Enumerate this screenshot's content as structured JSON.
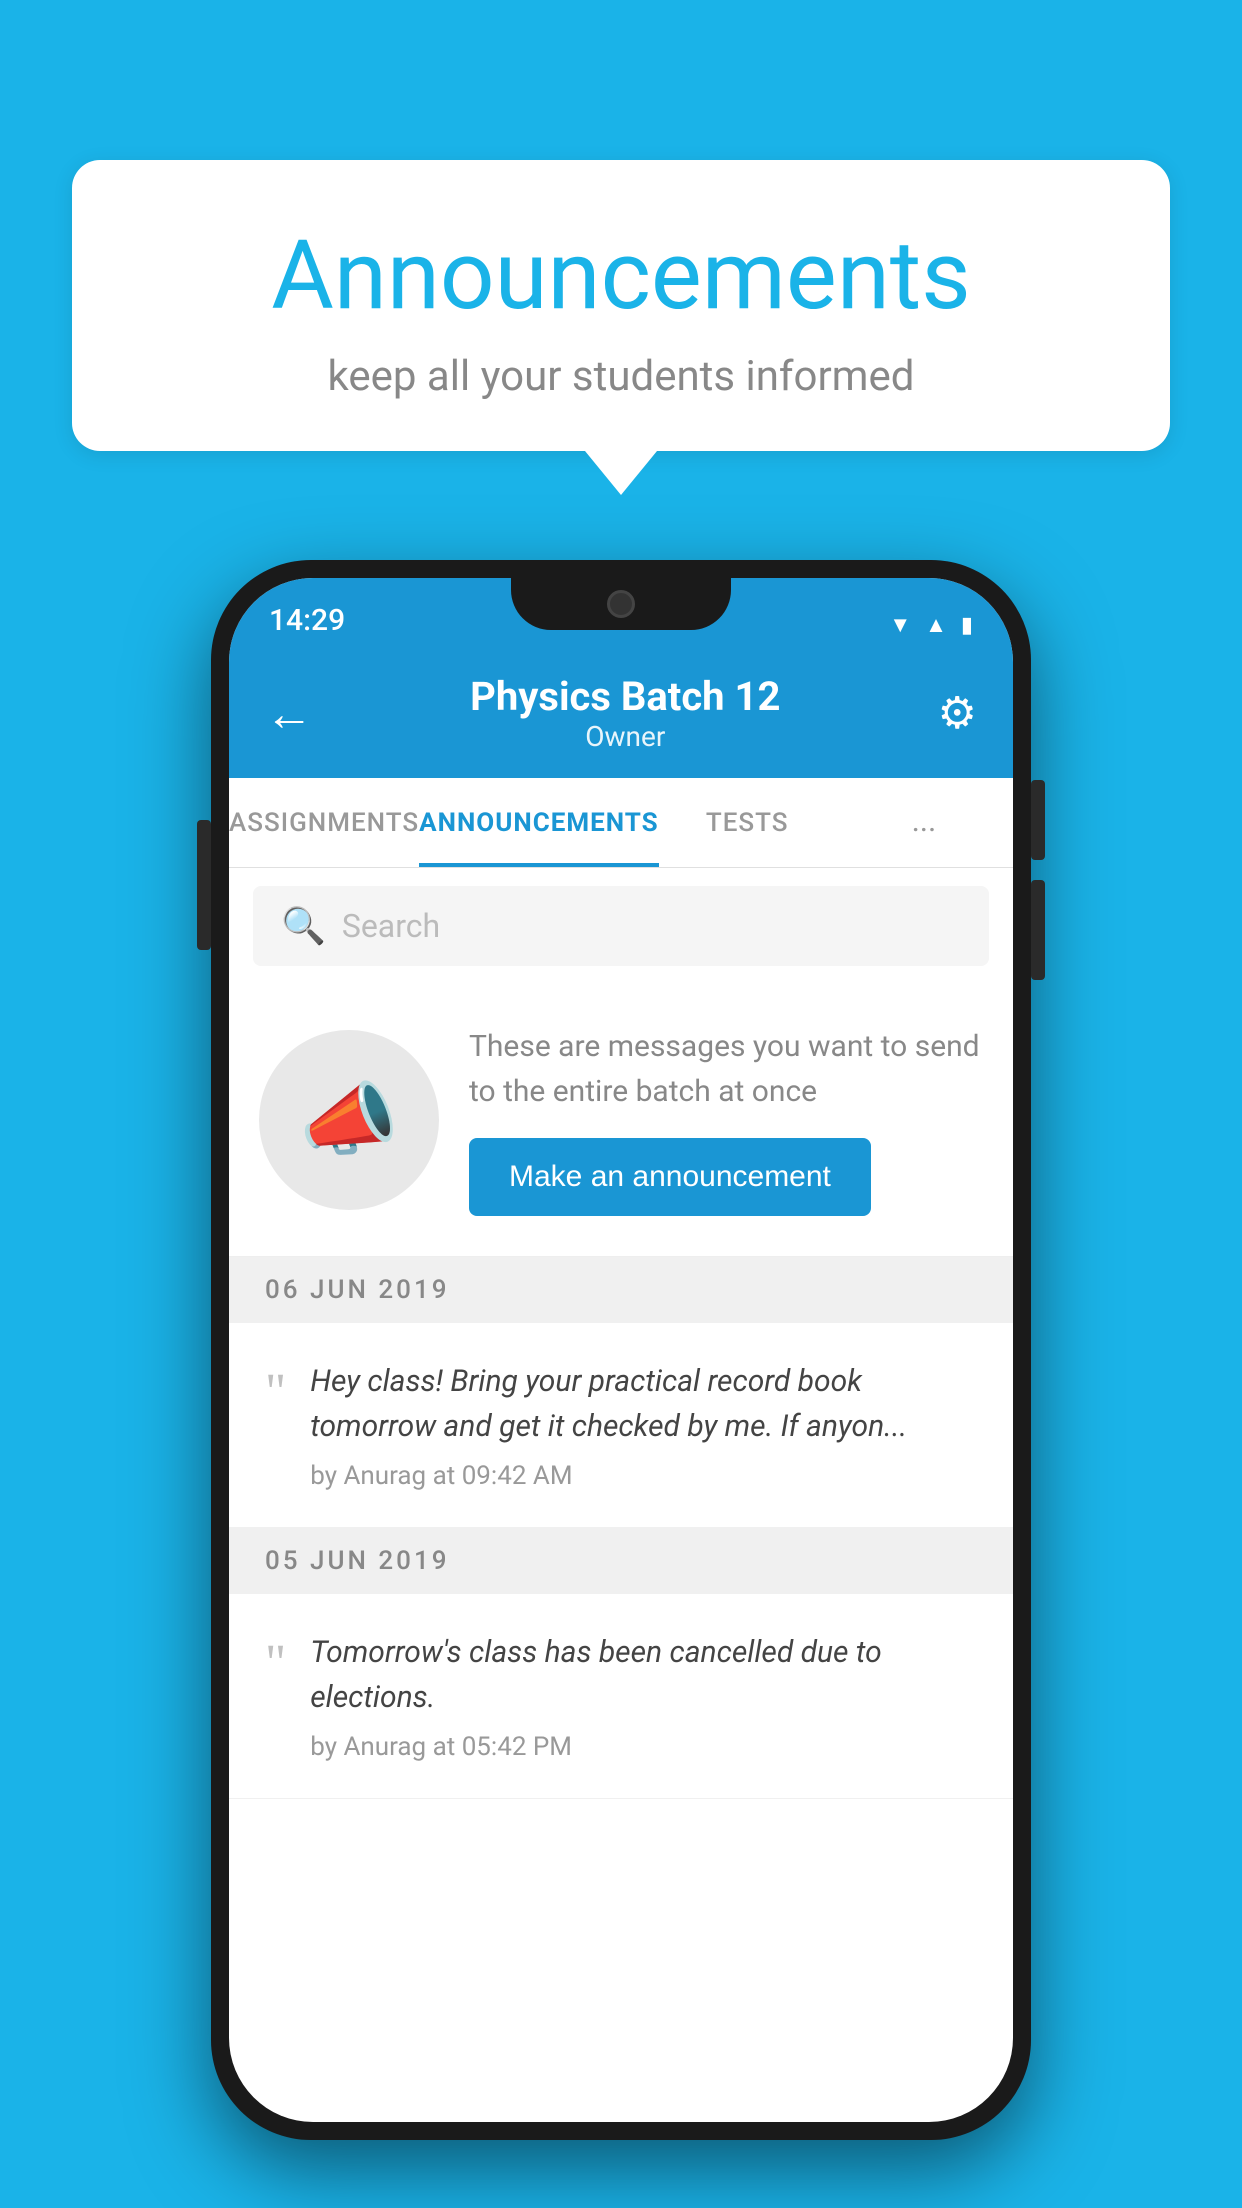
{
  "background_color": "#1ab3e8",
  "speech_bubble": {
    "title": "Announcements",
    "subtitle": "keep all your students informed"
  },
  "phone": {
    "status_bar": {
      "time": "14:29",
      "icons": [
        "wifi",
        "signal",
        "battery"
      ]
    },
    "top_bar": {
      "back_label": "←",
      "title": "Physics Batch 12",
      "subtitle": "Owner",
      "gear_label": "⚙"
    },
    "tabs": [
      {
        "label": "ASSIGNMENTS",
        "active": false
      },
      {
        "label": "ANNOUNCEMENTS",
        "active": true
      },
      {
        "label": "TESTS",
        "active": false
      },
      {
        "label": "...",
        "active": false
      }
    ],
    "search": {
      "placeholder": "Search"
    },
    "announcement_prompt": {
      "description": "These are messages you want to send to the entire batch at once",
      "button_label": "Make an announcement"
    },
    "messages": [
      {
        "date": "06  JUN  2019",
        "text": "Hey class! Bring your practical record book tomorrow and get it checked by me. If anyon...",
        "author": "by Anurag at 09:42 AM"
      },
      {
        "date": "05  JUN  2019",
        "text": "Tomorrow's class has been cancelled due to elections.",
        "author": "by Anurag at 05:42 PM"
      }
    ]
  }
}
